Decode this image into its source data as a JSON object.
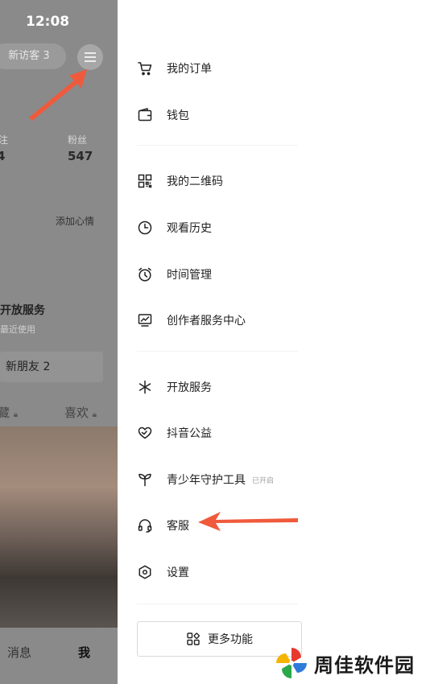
{
  "status_bar": {
    "time": "12:08"
  },
  "profile_bg": {
    "visitors_label": "新访客 3",
    "stats": [
      {
        "label": "注",
        "value": "4"
      },
      {
        "label": "粉丝",
        "value": "547"
      }
    ],
    "mood_label": "添加心情",
    "open_service_title": "开放服务",
    "open_service_sub": "最近使用",
    "new_friends": "新朋友 2",
    "tabs": [
      {
        "label": "藏"
      },
      {
        "label": "喜欢"
      }
    ],
    "bottom_nav": [
      {
        "label": "消息"
      },
      {
        "label": "我"
      }
    ]
  },
  "menu": {
    "items": [
      {
        "icon": "cart-icon",
        "label": "我的订单"
      },
      {
        "icon": "wallet-icon",
        "label": "钱包"
      },
      {
        "icon": "qr-code-icon",
        "label": "我的二维码"
      },
      {
        "icon": "clock-icon",
        "label": "观看历史"
      },
      {
        "icon": "alarm-icon",
        "label": "时间管理"
      },
      {
        "icon": "monitor-chart-icon",
        "label": "创作者服务中心"
      },
      {
        "icon": "sparkle-icon",
        "label": "开放服务"
      },
      {
        "icon": "heart-hand-icon",
        "label": "抖音公益"
      },
      {
        "icon": "sprout-icon",
        "label": "青少年守护工具",
        "tag": "已开启"
      },
      {
        "icon": "headset-icon",
        "label": "客服"
      },
      {
        "icon": "hexagon-settings-icon",
        "label": "设置"
      }
    ],
    "more_label": "更多功能"
  },
  "watermark": {
    "text": "周佳软件园"
  },
  "colors": {
    "arrow": "#f05a3c",
    "overlay": "#8a8a8a",
    "text": "#222222"
  }
}
